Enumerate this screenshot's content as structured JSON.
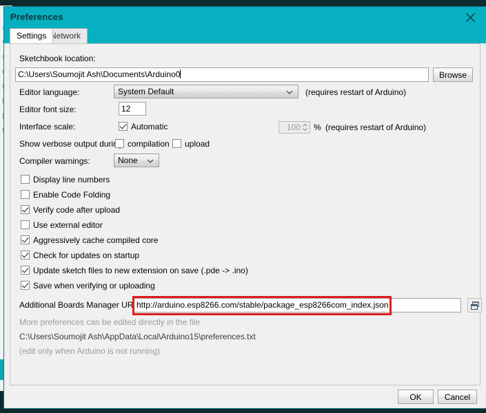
{
  "window": {
    "title": "Preferences",
    "close_icon": "close-icon"
  },
  "tabs": [
    {
      "label": "Settings",
      "active": true
    },
    {
      "label": "Network",
      "active": false
    }
  ],
  "settings": {
    "sketchbook": {
      "label": "Sketchbook location:",
      "value": "C:\\Users\\Soumojit Ash\\Documents\\Arduino0",
      "browse_label": "Browse"
    },
    "editor_language": {
      "label": "Editor language:",
      "value": "System Default",
      "note": "(requires restart of Arduino)"
    },
    "editor_font_size": {
      "label": "Editor font size:",
      "value": "12"
    },
    "interface_scale": {
      "label": "Interface scale:",
      "automatic_label": "Automatic",
      "automatic_checked": true,
      "scale_value": "100",
      "percent": "%",
      "note": "(requires restart of Arduino)"
    },
    "verbose_output": {
      "label": "Show verbose output during:",
      "compilation_label": "compilation",
      "compilation_checked": false,
      "upload_label": "upload",
      "upload_checked": false
    },
    "compiler_warnings": {
      "label": "Compiler warnings:",
      "value": "None"
    },
    "checkboxes": [
      {
        "label": "Display line numbers",
        "checked": false
      },
      {
        "label": "Enable Code Folding",
        "checked": false
      },
      {
        "label": "Verify code after upload",
        "checked": true
      },
      {
        "label": "Use external editor",
        "checked": false
      },
      {
        "label": "Aggressively cache compiled core",
        "checked": true
      },
      {
        "label": "Check for updates on startup",
        "checked": true
      },
      {
        "label": "Update sketch files to new extension on save (.pde -> .ino)",
        "checked": true
      },
      {
        "label": "Save when verifying or uploading",
        "checked": true
      }
    ],
    "boards_manager": {
      "label": "Additional Boards Manager URLs:",
      "value": "http://arduino.esp8266.com/stable/package_esp8266com_index.json",
      "copy_icon": "window-copy-icon",
      "highlight_color": "#e01b1b"
    },
    "footer": {
      "line1": "More preferences can be edited directly in the file",
      "line2": "C:\\Users\\Soumojit Ash\\AppData\\Local\\Arduino15\\preferences.txt",
      "line3": "(edit only when Arduino is not running)"
    }
  },
  "buttons": {
    "ok": "OK",
    "cancel": "Cancel"
  },
  "background_window": {
    "lines": [
      "1",
      "A",
      "v",
      "r",
      "e",
      "f",
      "b",
      "f",
      "t"
    ]
  },
  "colors": {
    "titlebar": "#06b0c1",
    "dialog_bg": "#f0f0f0",
    "highlight_red": "#e01b1b",
    "desktop": "#0b2b30"
  }
}
